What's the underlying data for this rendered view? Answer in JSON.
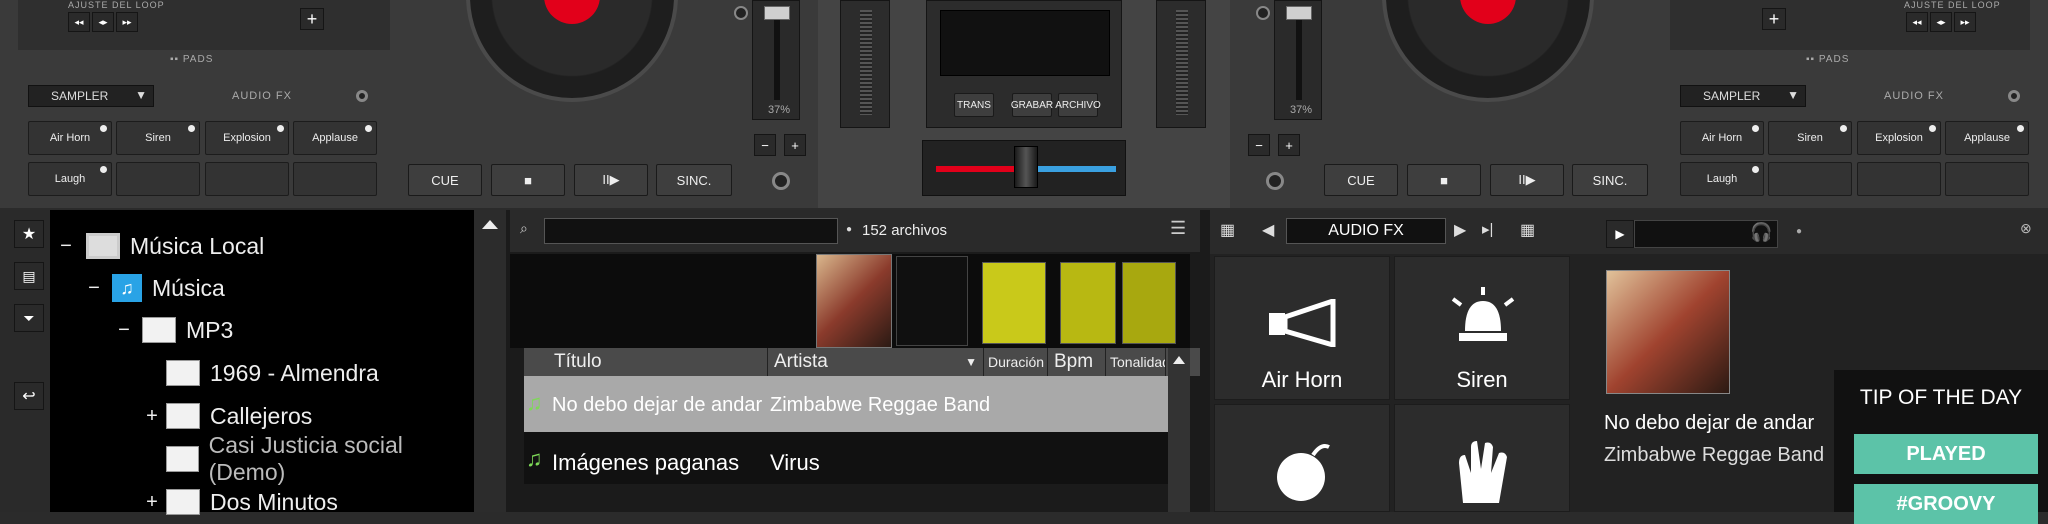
{
  "deck_left": {
    "loop_label": "AJUSTE DEL LOOP",
    "pads_label": "PADS",
    "sampler_select": "SAMPLER",
    "audio_fx_label": "AUDIO FX",
    "pads": [
      "Air Horn",
      "Siren",
      "Explosion",
      "Applause",
      "Laugh"
    ],
    "pitch_value": "37%",
    "transport": {
      "cue": "CUE",
      "stop": "■",
      "play_pause": "II▶",
      "sync": "SINC."
    }
  },
  "deck_right": {
    "loop_label": "AJUSTE DEL LOOP",
    "pads_label": "PADS",
    "sampler_select": "SAMPLER",
    "audio_fx_label": "AUDIO FX",
    "pads": [
      "Air Horn",
      "Siren",
      "Explosion",
      "Applause",
      "Laugh"
    ],
    "pitch_value": "37%",
    "transport": {
      "cue": "CUE",
      "stop": "■",
      "play_pause": "II▶",
      "sync": "SINC."
    }
  },
  "mixer": {
    "buttons": {
      "trans": "TRANS",
      "grabar": "GRABAR",
      "archivo": "ARCHIVO"
    }
  },
  "browser": {
    "tree": [
      {
        "label": "Música Local",
        "toggle": "−",
        "icon": "computer-icon"
      },
      {
        "label": "Música",
        "toggle": "−",
        "icon": "music-folder-icon"
      },
      {
        "label": "MP3",
        "toggle": "−",
        "icon": "folder-icon"
      },
      {
        "label": "1969 - Almendra",
        "toggle": "",
        "icon": "folder-icon"
      },
      {
        "label": "Callejeros",
        "toggle": "+",
        "icon": "folder-icon"
      },
      {
        "label": "Casi Justicia social (Demo)",
        "toggle": "",
        "icon": "folder-icon"
      },
      {
        "label": "Dos Minutos",
        "toggle": "+",
        "icon": "folder-icon"
      }
    ],
    "search_placeholder": "",
    "file_count": "152 archivos",
    "columns": [
      "Título",
      "Artista",
      "Duración",
      "Bpm",
      "Tonalidad"
    ],
    "rows": [
      {
        "title": "No debo dejar de andar",
        "artist": "Zimbabwe Reggae Band"
      },
      {
        "title": "Imágenes paganas",
        "artist": "Virus"
      }
    ]
  },
  "fx_panel": {
    "title": "AUDIO FX",
    "effects": [
      "Air Horn",
      "Siren",
      "Explosion",
      "Applause"
    ]
  },
  "info_panel": {
    "track_title": "No debo dejar de andar",
    "track_artist": "Zimbabwe Reggae Band",
    "tip_title": "TIP OF THE DAY",
    "tip_played": "PLAYED",
    "tip_tag": "#GROOVY"
  },
  "colors": {
    "accent_red": "#e2001a",
    "accent_blue": "#3aa0e0",
    "played_green": "#5cc3a8"
  }
}
